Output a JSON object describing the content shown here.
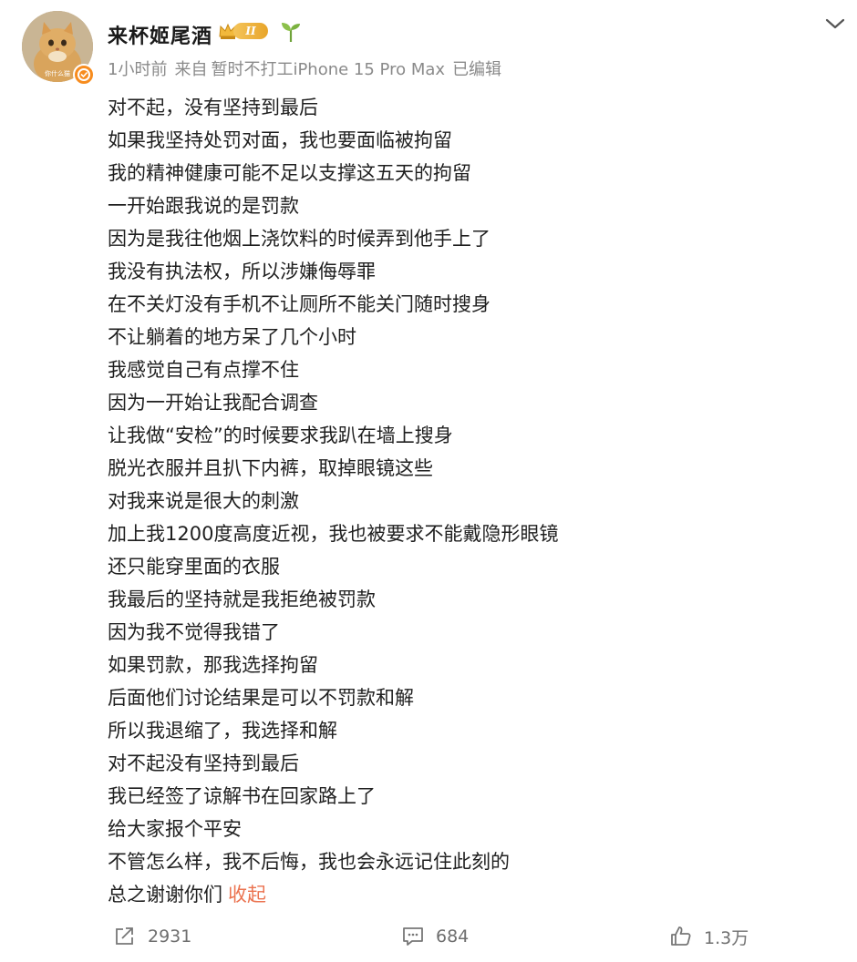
{
  "author": {
    "name": "来杯姬尾酒",
    "vip_level": "II",
    "avatar_caption": "你什么猫"
  },
  "meta": {
    "time": "1小时前",
    "source_prefix": "来自",
    "device": "暂时不打工iPhone 15 Pro Max",
    "edited": "已编辑"
  },
  "content": {
    "lines": [
      "对不起，没有坚持到最后",
      "如果我坚持处罚对面，我也要面临被拘留",
      "我的精神健康可能不足以支撑这五天的拘留",
      "一开始跟我说的是罚款",
      "因为是我往他烟上浇饮料的时候弄到他手上了",
      "我没有执法权，所以涉嫌侮辱罪",
      "在不关灯没有手机不让厕所不能关门随时搜身",
      "不让躺着的地方呆了几个小时",
      "我感觉自己有点撑不住",
      "因为一开始让我配合调查",
      "让我做“安检”的时候要求我趴在墙上搜身",
      "脱光衣服并且扒下内裤，取掉眼镜这些",
      "对我来说是很大的刺激",
      "加上我1200度高度近视，我也被要求不能戴隐形眼镜",
      "还只能穿里面的衣服",
      "我最后的坚持就是我拒绝被罚款",
      "因为我不觉得我错了",
      "如果罚款，那我选择拘留",
      "后面他们讨论结果是可以不罚款和解",
      "所以我退缩了，我选择和解",
      "对不起没有坚持到最后",
      "我已经签了谅解书在回家路上了",
      "给大家报个平安",
      "不管怎么样，我不后悔，我也会永远记住此刻的",
      "总之谢谢你们"
    ],
    "collapse_label": "收起"
  },
  "actions": {
    "reposts": "2931",
    "comments": "684",
    "likes": "1.3万"
  },
  "colors": {
    "link": "#eb7350",
    "meta_text": "#8a8a8a",
    "verified": "#f78c1e",
    "vip_gold": "#e8a52a"
  },
  "icons": [
    "chevron-down-icon",
    "crown-icon",
    "sprout-icon",
    "verified-icon",
    "repost-icon",
    "comment-icon",
    "like-icon"
  ]
}
